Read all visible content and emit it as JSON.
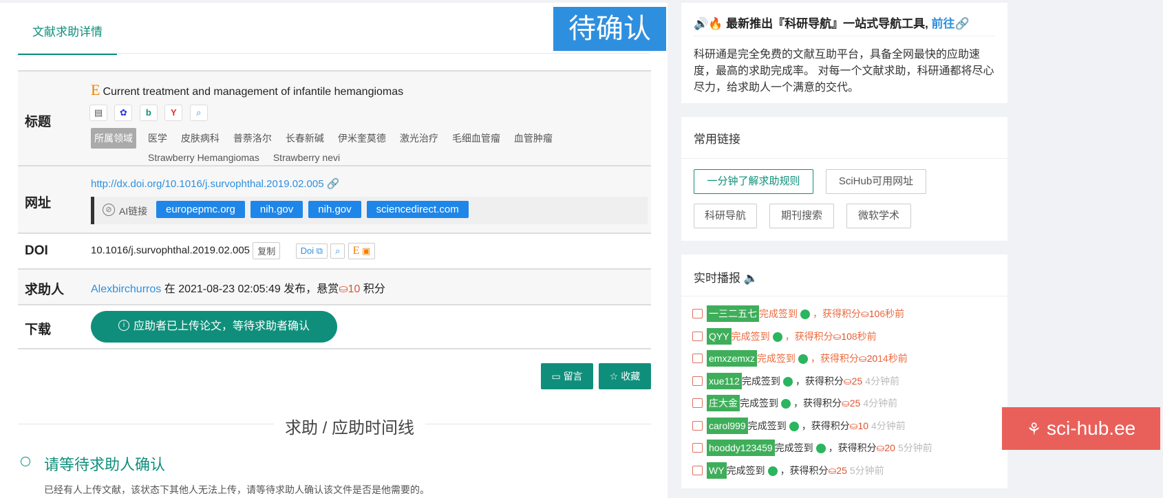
{
  "tab": {
    "label": "文献求助详情"
  },
  "status_badge": "待确认",
  "title_row": {
    "label": "标题",
    "paper_title": "Current treatment and management of infantile hemangiomas",
    "field_tag": "所属领域",
    "keywords": [
      "医学",
      "皮肤病科",
      "普萘洛尔",
      "长春新碱",
      "伊米奎莫德",
      "激光治疗",
      "毛细血管瘤",
      "血管肿瘤",
      "Strawberry Hemangiomas",
      "Strawberry nevi"
    ]
  },
  "url_row": {
    "label": "网址",
    "url": "http://dx.doi.org/10.1016/j.survophthal.2019.02.005",
    "ai_label": "AI链接",
    "ai_links": [
      "europepmc.org",
      "nih.gov",
      "nih.gov",
      "sciencedirect.com"
    ]
  },
  "doi_row": {
    "label": "DOI",
    "doi": "10.1016/j.survophthal.2019.02.005",
    "copy_label": "复制",
    "doi_btn": "Doi"
  },
  "requester_row": {
    "label": "求助人",
    "user": "Alexbirchurros",
    "text_at": "在",
    "datetime": "2021-08-23 02:05:49",
    "text_post": "发布，悬赏",
    "reward": "10",
    "points": "积分"
  },
  "download_row": {
    "label": "下载",
    "button": "应助者已上传论文，等待求助者确认"
  },
  "actions": {
    "comment": "留言",
    "favorite": "收藏"
  },
  "timeline": {
    "title": "求助 / 应助时间线",
    "step_title": "请等待求助人确认",
    "step_desc": "已经有人上传文献，该状态下其他人无法上传，请等待求助人确认该文件是否是他需要的。"
  },
  "notice": {
    "headline": "最新推出『科研导航』一站式导航工具,",
    "go_link": "前往",
    "desc": "科研通是完全免费的文献互助平台，具备全网最快的应助速度，最高的求助完成率。 对每一个文献求助，科研通都将尽心尽力，给求助人一个满意的交代。"
  },
  "common_links": {
    "title": "常用链接",
    "items": [
      "一分钟了解求助规则",
      "SciHub可用网址",
      "科研导航",
      "期刊搜索",
      "微软学术"
    ]
  },
  "broadcast": {
    "title": "实时播报",
    "checkin": "完成签到",
    "gain": "，获得积分",
    "items": [
      {
        "user": "一三二五七",
        "pts": "10",
        "time": "6秒前",
        "color": "#ec6a3e",
        "name_bg": "#3fae5a"
      },
      {
        "user": "QYY",
        "pts": "10",
        "time": "8秒前",
        "color": "#ec6a3e",
        "name_bg": "#3fae5a"
      },
      {
        "user": "emxzemxz",
        "pts": "20",
        "time": "14秒前",
        "color": "#ec6a3e",
        "name_bg": "#3fae5a"
      },
      {
        "user": "xue112",
        "pts": "25",
        "time": "4分钟前",
        "color": "#333333",
        "name_bg": "#3fae5a"
      },
      {
        "user": "庄大金",
        "pts": "25",
        "time": "4分钟前",
        "color": "#333333",
        "name_bg": "#3fae5a"
      },
      {
        "user": "carol999",
        "pts": "10",
        "time": "4分钟前",
        "color": "#333333",
        "name_bg": "#3fae5a"
      },
      {
        "user": "hooddy123459",
        "pts": "20",
        "time": "5分钟前",
        "color": "#333333",
        "name_bg": "#3fae5a"
      },
      {
        "user": "WY",
        "pts": "25",
        "time": "5分钟前",
        "color": "#333333",
        "name_bg": "#3fae5a"
      }
    ]
  },
  "scihub": {
    "label": "sci-hub.ee"
  },
  "colors": {
    "brand": "#0f8f7b",
    "badge": "#2e8fdf",
    "link": "#1e86e8",
    "reward": "#e0532f",
    "scihub": "#e9605a"
  }
}
